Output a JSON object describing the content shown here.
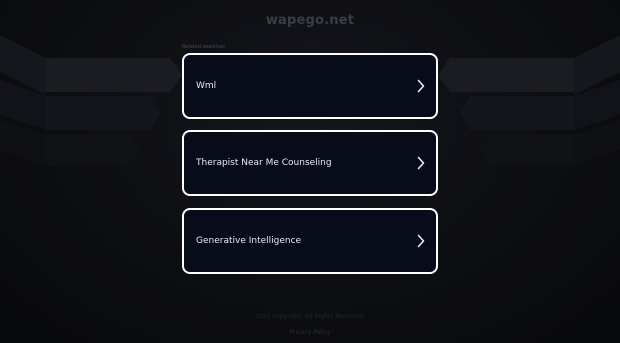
{
  "site": {
    "title": "wapego.net"
  },
  "searches": {
    "section_label": "Related searches",
    "items": [
      {
        "label": "Wml"
      },
      {
        "label": "Therapist Near Me Counseling"
      },
      {
        "label": "Generative Intelligence"
      }
    ]
  },
  "footer": {
    "line1": "2025 Copyright. All Rights Reserved.",
    "line2": "Privacy Policy"
  },
  "colors": {
    "background": "#0b0c10",
    "card_background": "#080b1a",
    "card_border": "#ffffff",
    "card_text": "#e9ebf2"
  },
  "icons": {
    "card_arrow": "chevron-right-icon"
  }
}
